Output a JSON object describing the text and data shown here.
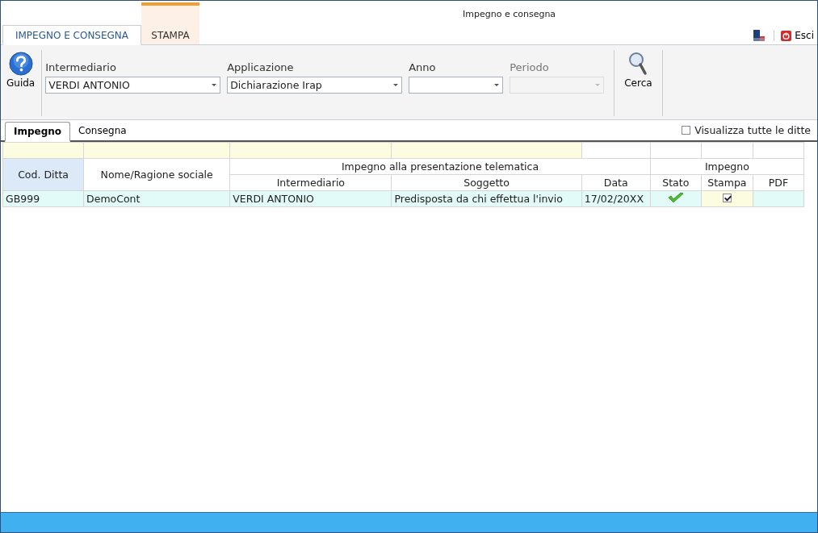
{
  "window": {
    "title": "Impegno e consegna"
  },
  "ribbon_tabs": [
    {
      "label": "IMPEGNO E CONSEGNA",
      "selected": true
    },
    {
      "label": "STAMPA",
      "selected": false
    }
  ],
  "exit_button": {
    "label": "Esci"
  },
  "toolbar": {
    "help_button": "Guida",
    "search_button": "Cerca",
    "fields": [
      {
        "label": "Intermediario",
        "value": "VERDI ANTONIO",
        "disabled": false
      },
      {
        "label": "Applicazione",
        "value": "Dichiarazione Irap",
        "disabled": false
      },
      {
        "label": "Anno",
        "disabled": false
      },
      {
        "label": "Periodo",
        "disabled": true
      }
    ]
  },
  "sub_tabs": [
    {
      "label": "Impegno",
      "selected": true
    },
    {
      "label": "Consegna",
      "selected": false
    }
  ],
  "show_all": {
    "label": "Visualizza tutte le ditte",
    "checked": false
  },
  "table": {
    "groups": [
      {
        "label": "Impegno alla presentazione telematica"
      },
      {
        "label": "Impegno"
      }
    ],
    "columns": [
      "Cod. Ditta",
      "Nome/Ragione sociale",
      "Intermediario",
      "Soggetto",
      "Data",
      "Stato",
      "Stampa",
      "PDF"
    ],
    "rows": [
      {
        "cod": "GB999",
        "nome": "DemoCont",
        "intermediario": "VERDI ANTONIO",
        "soggetto": "Predisposta da chi effettua l'invio",
        "data": "17/02/20XX",
        "stato_ok": true,
        "stampa": true
      }
    ]
  }
}
